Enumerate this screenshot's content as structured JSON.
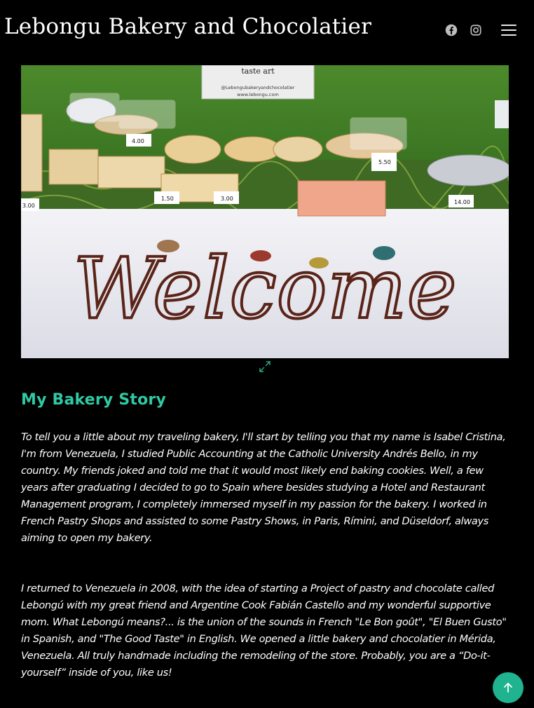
{
  "header": {
    "brand": "Lebongu Bakery and Chocolatier",
    "icons": [
      "facebook-icon",
      "instagram-icon",
      "menu-icon"
    ]
  },
  "hero": {
    "image_alt": "Bakery market stall with welcome sign",
    "sign_lines": [
      "taste art",
      "@Lebongubakeryandchocolatier",
      "www.lebongu.com"
    ],
    "price_tags": [
      "3.00",
      "1.50",
      "3.00",
      "5.50",
      "14.00",
      "4.00"
    ],
    "welcome_word": "Welcome"
  },
  "story": {
    "title": "My Bakery Story",
    "paragraphs": [
      "To tell you a little about my traveling bakery, I'll start by telling you that my name is Isabel Cristina, I'm from Venezuela, I studied Public Accounting at the Catholic University Andrés Bello, in my country. My friends joked and told me that it would most likely end baking cookies. Well, a few years after graduating I decided to go to Spain where besides studying a Hotel and Restaurant Management program, I completely immersed myself in my passion for the bakery. I worked in French Pastry Shops and assisted to some Pastry Shows, in Paris, Rímini, and Düseldorf, always aiming to open my bakery.",
      "I returned to Venezuela in 2008, with the idea of starting a Project of pastry and chocolate called Lebongú with my great friend and Argentine Cook Fabián Castello and my wonderful supportive mom. What Lebongú means?... is the union of the sounds in French \"Le Bon goût\", \"El Buen Gusto\" in Spanish, and \"The Good Taste\" in English. We opened a little bakery and chocolatier in Mérida, Venezuela. All truly handmade including the remodeling of the store. Probably, you are a “Do-it-yourself” inside of you, like us!"
    ]
  },
  "colors": {
    "background": "#000000",
    "accent": "#2fc9a3",
    "button": "#1fb38f"
  }
}
